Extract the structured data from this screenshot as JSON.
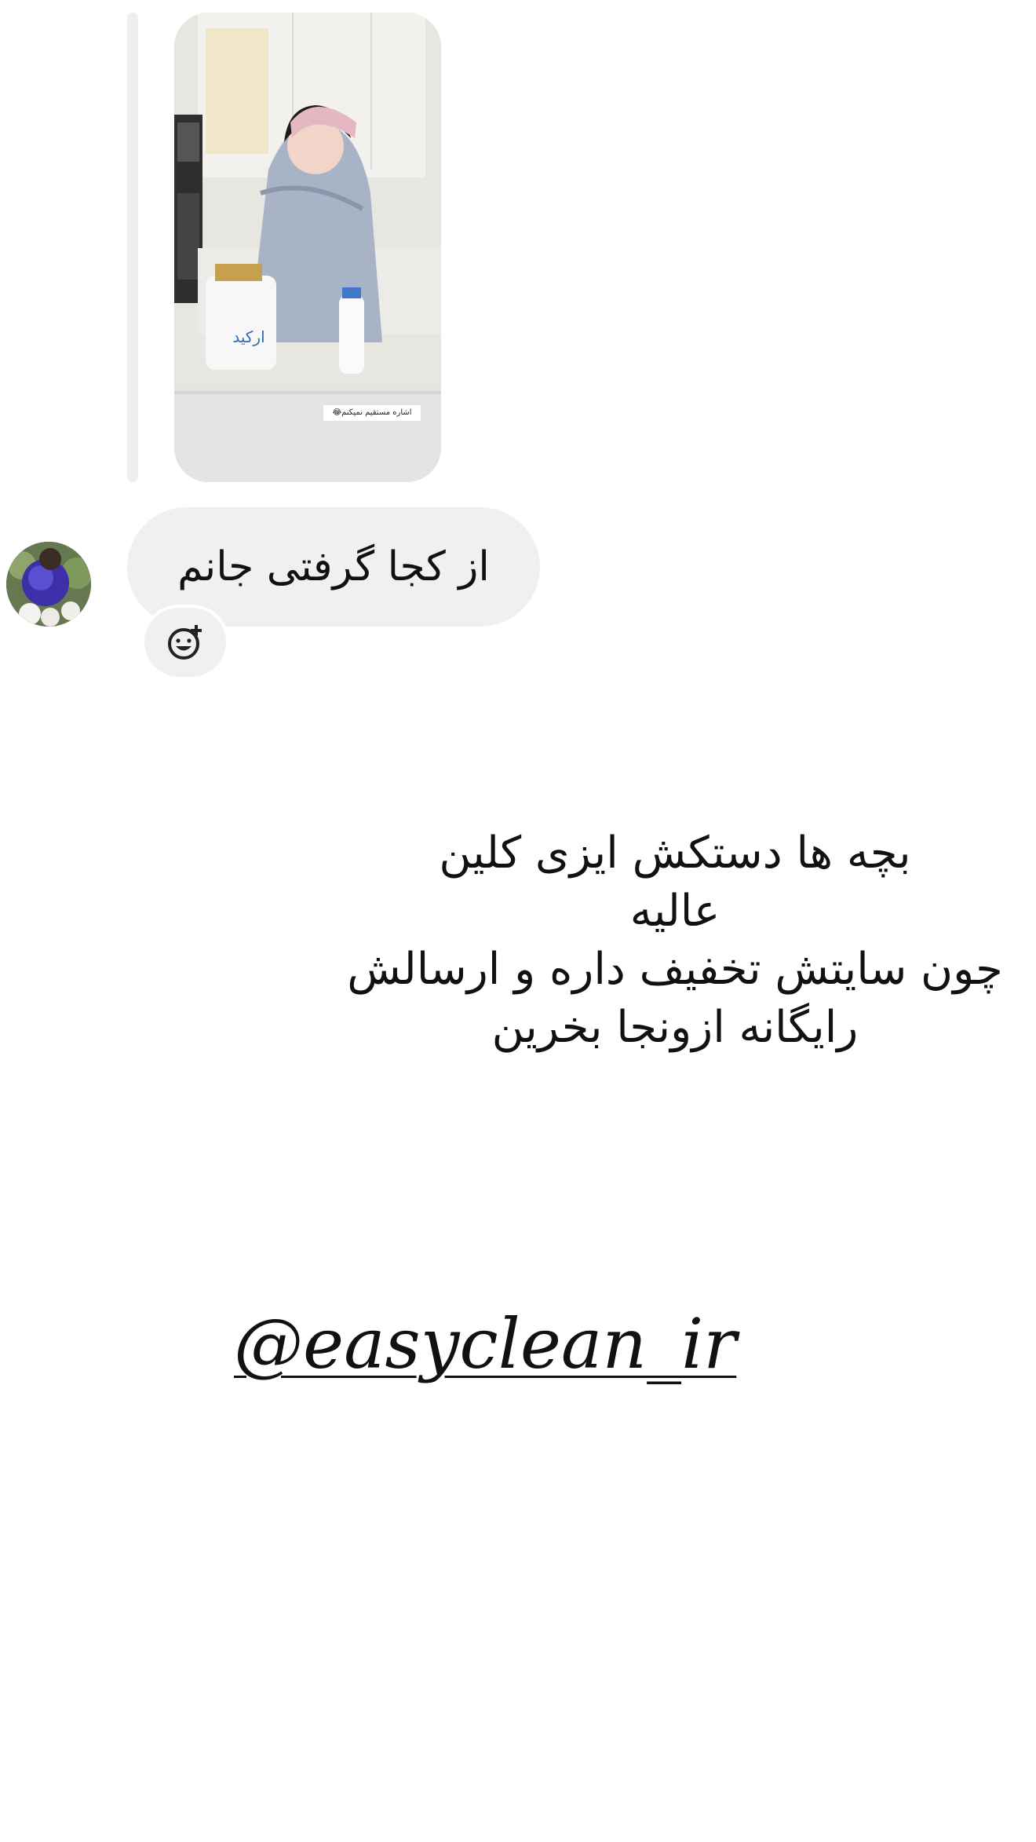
{
  "shared_post": {
    "caption": "اشاره مستقیم نمیکنم😂"
  },
  "message": {
    "text": "از کجا گرفتی جانم",
    "add_reaction_icon": "add-reaction-icon"
  },
  "story_text": {
    "line1": "بچه ها دستکش ایزی کلین",
    "line2": "عالیه",
    "line3": "چون سایتش تخفیف داره و ارسالش",
    "line4": "رایگانه ازونجا بخرین"
  },
  "mention": {
    "handle": "@easyclean_ir"
  },
  "colors": {
    "bubble": "#eff0f2",
    "background": "#ffffff",
    "text": "#111111"
  }
}
